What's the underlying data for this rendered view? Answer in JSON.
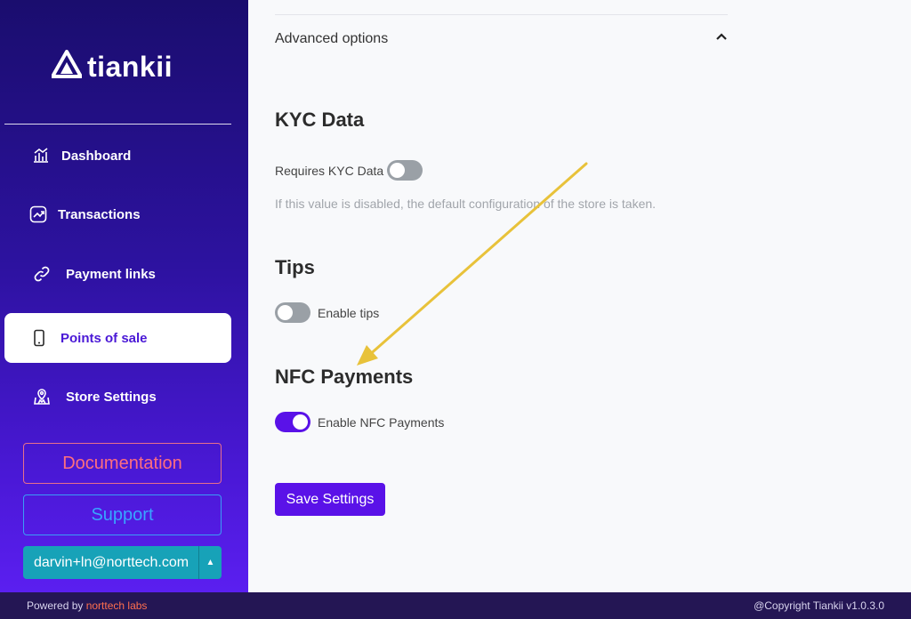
{
  "brand": {
    "name": "tiankii"
  },
  "sidebar": {
    "items": [
      {
        "label": "Dashboard",
        "icon": "chart-bars-icon"
      },
      {
        "label": "Transactions",
        "icon": "trend-up-icon"
      },
      {
        "label": "Payment links",
        "icon": "link-icon"
      },
      {
        "label": "Points of sale",
        "icon": "smartphone-icon",
        "active": true
      },
      {
        "label": "Store Settings",
        "icon": "store-map-icon"
      }
    ],
    "documentation_label": "Documentation",
    "support_label": "Support",
    "user_email": "darvin+ln@norttech.com"
  },
  "main": {
    "advanced_options_label": "Advanced options",
    "kyc": {
      "title": "KYC Data",
      "toggle_label": "Requires KYC Data",
      "enabled": false,
      "help": "If this value is disabled, the default configuration of the store is taken."
    },
    "tips": {
      "title": "Tips",
      "toggle_label": "Enable tips",
      "enabled": false
    },
    "nfc": {
      "title": "NFC Payments",
      "toggle_label": "Enable NFC Payments",
      "enabled": true
    },
    "save_label": "Save Settings"
  },
  "footer": {
    "powered_by": "Powered by",
    "powered_link": "norttech labs",
    "copyright": "@Copyright Tiankii v1.0.3.0"
  },
  "colors": {
    "accent": "#5a12e8",
    "sidebar_top": "#1a0d6e",
    "sidebar_bottom": "#5b1ff0",
    "documentation": "#ff6f7e",
    "support": "#38a5ff",
    "user_select": "#17a2b8",
    "annotation_arrow": "#e8c23a"
  }
}
